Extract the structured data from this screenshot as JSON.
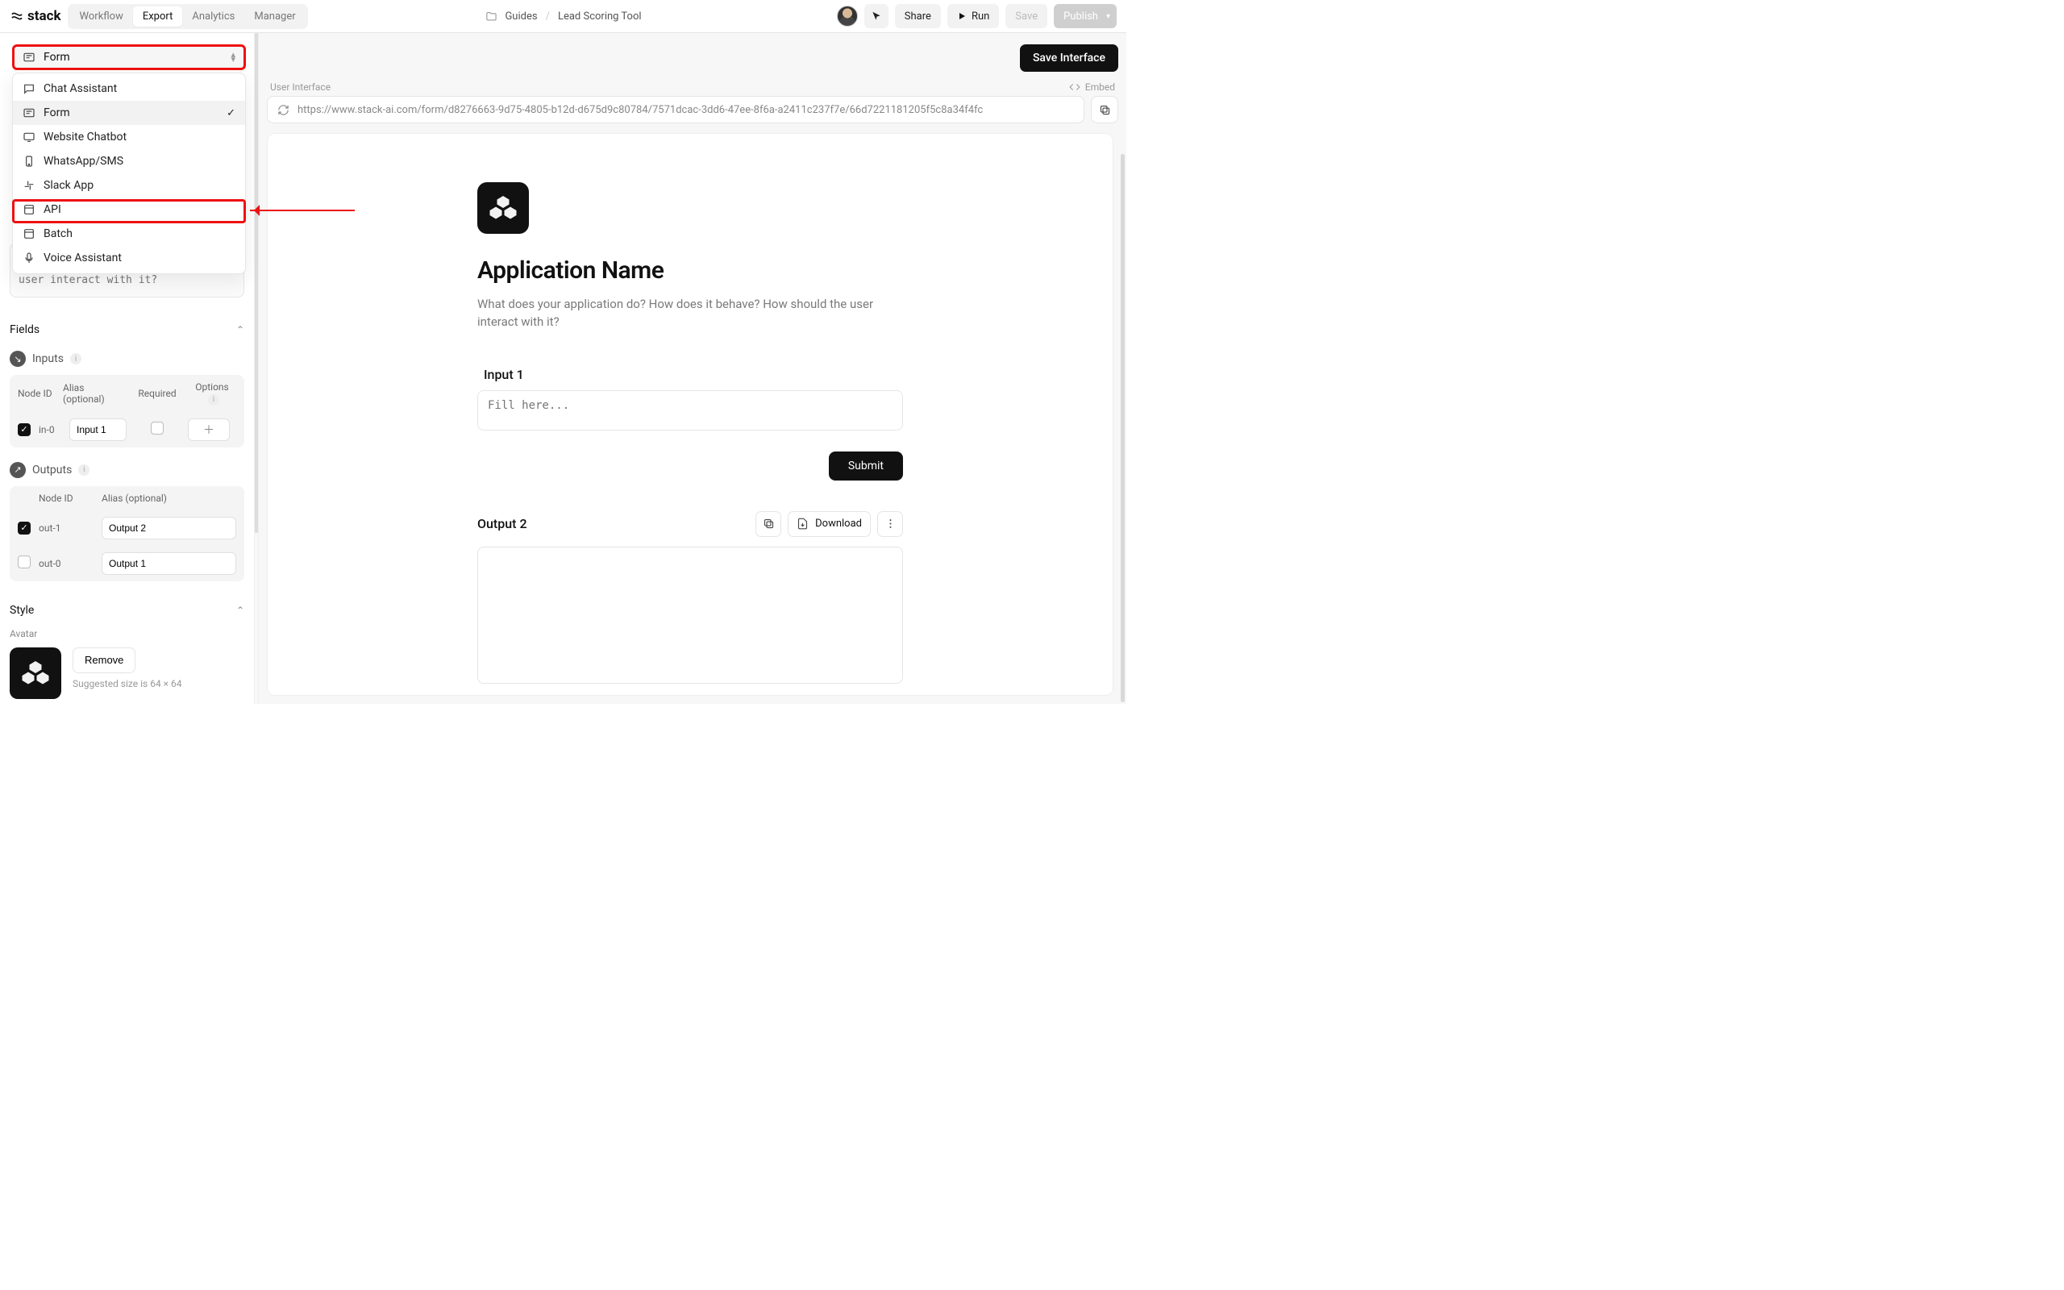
{
  "logo_text": "stack",
  "nav_tabs": {
    "workflow": "Workflow",
    "export": "Export",
    "analytics": "Analytics",
    "manager": "Manager"
  },
  "breadcrumb": {
    "folder": "Guides",
    "item": "Lead Scoring Tool"
  },
  "header_buttons": {
    "share": "Share",
    "run": "Run",
    "save": "Save",
    "publish": "Publish"
  },
  "save_interface_label": "Save Interface",
  "ui_bar": {
    "left": "User Interface",
    "embed": "Embed"
  },
  "url": "https://www.stack-ai.com/form/d8276663-9d75-4805-b12d-d675d9c80784/7571dcac-3dd6-47ee-8f6a-a2411c237f7e/66d7221181205f5c8a34f4fc",
  "iface_selected": "Form",
  "dropdown_items": {
    "chat": "Chat Assistant",
    "form": "Form",
    "chatbot": "Website Chatbot",
    "whatsapp": "WhatsApp/SMS",
    "slack": "Slack App",
    "api": "API",
    "batch": "Batch",
    "voice": "Voice Assistant"
  },
  "sidebar_desc_placeholder": "What does your application do? How does it behave? How should the user interact with it?",
  "fields_section": "Fields",
  "inputs_label": "Inputs",
  "inputs_table": {
    "hdr_node": "Node ID",
    "hdr_alias": "Alias (optional)",
    "hdr_required": "Required",
    "hdr_options": "Options",
    "row_node": "in-0",
    "row_alias": "Input 1"
  },
  "outputs_label": "Outputs",
  "outputs_table": {
    "hdr_node": "Node ID",
    "hdr_alias": "Alias (optional)",
    "rows": [
      {
        "node": "out-1",
        "alias": "Output 2",
        "checked": true
      },
      {
        "node": "out-0",
        "alias": "Output 1",
        "checked": false
      }
    ]
  },
  "style_section": "Style",
  "avatar_label": "Avatar",
  "remove_label": "Remove",
  "avatar_hint": "Suggested size is 64 × 64",
  "preview": {
    "title": "Application Name",
    "desc": "What does your application do? How does it behave? How should the user interact with it?",
    "input_label": "Input 1",
    "input_placeholder": "Fill here...",
    "submit": "Submit",
    "output_label": "Output 2",
    "download": "Download"
  }
}
